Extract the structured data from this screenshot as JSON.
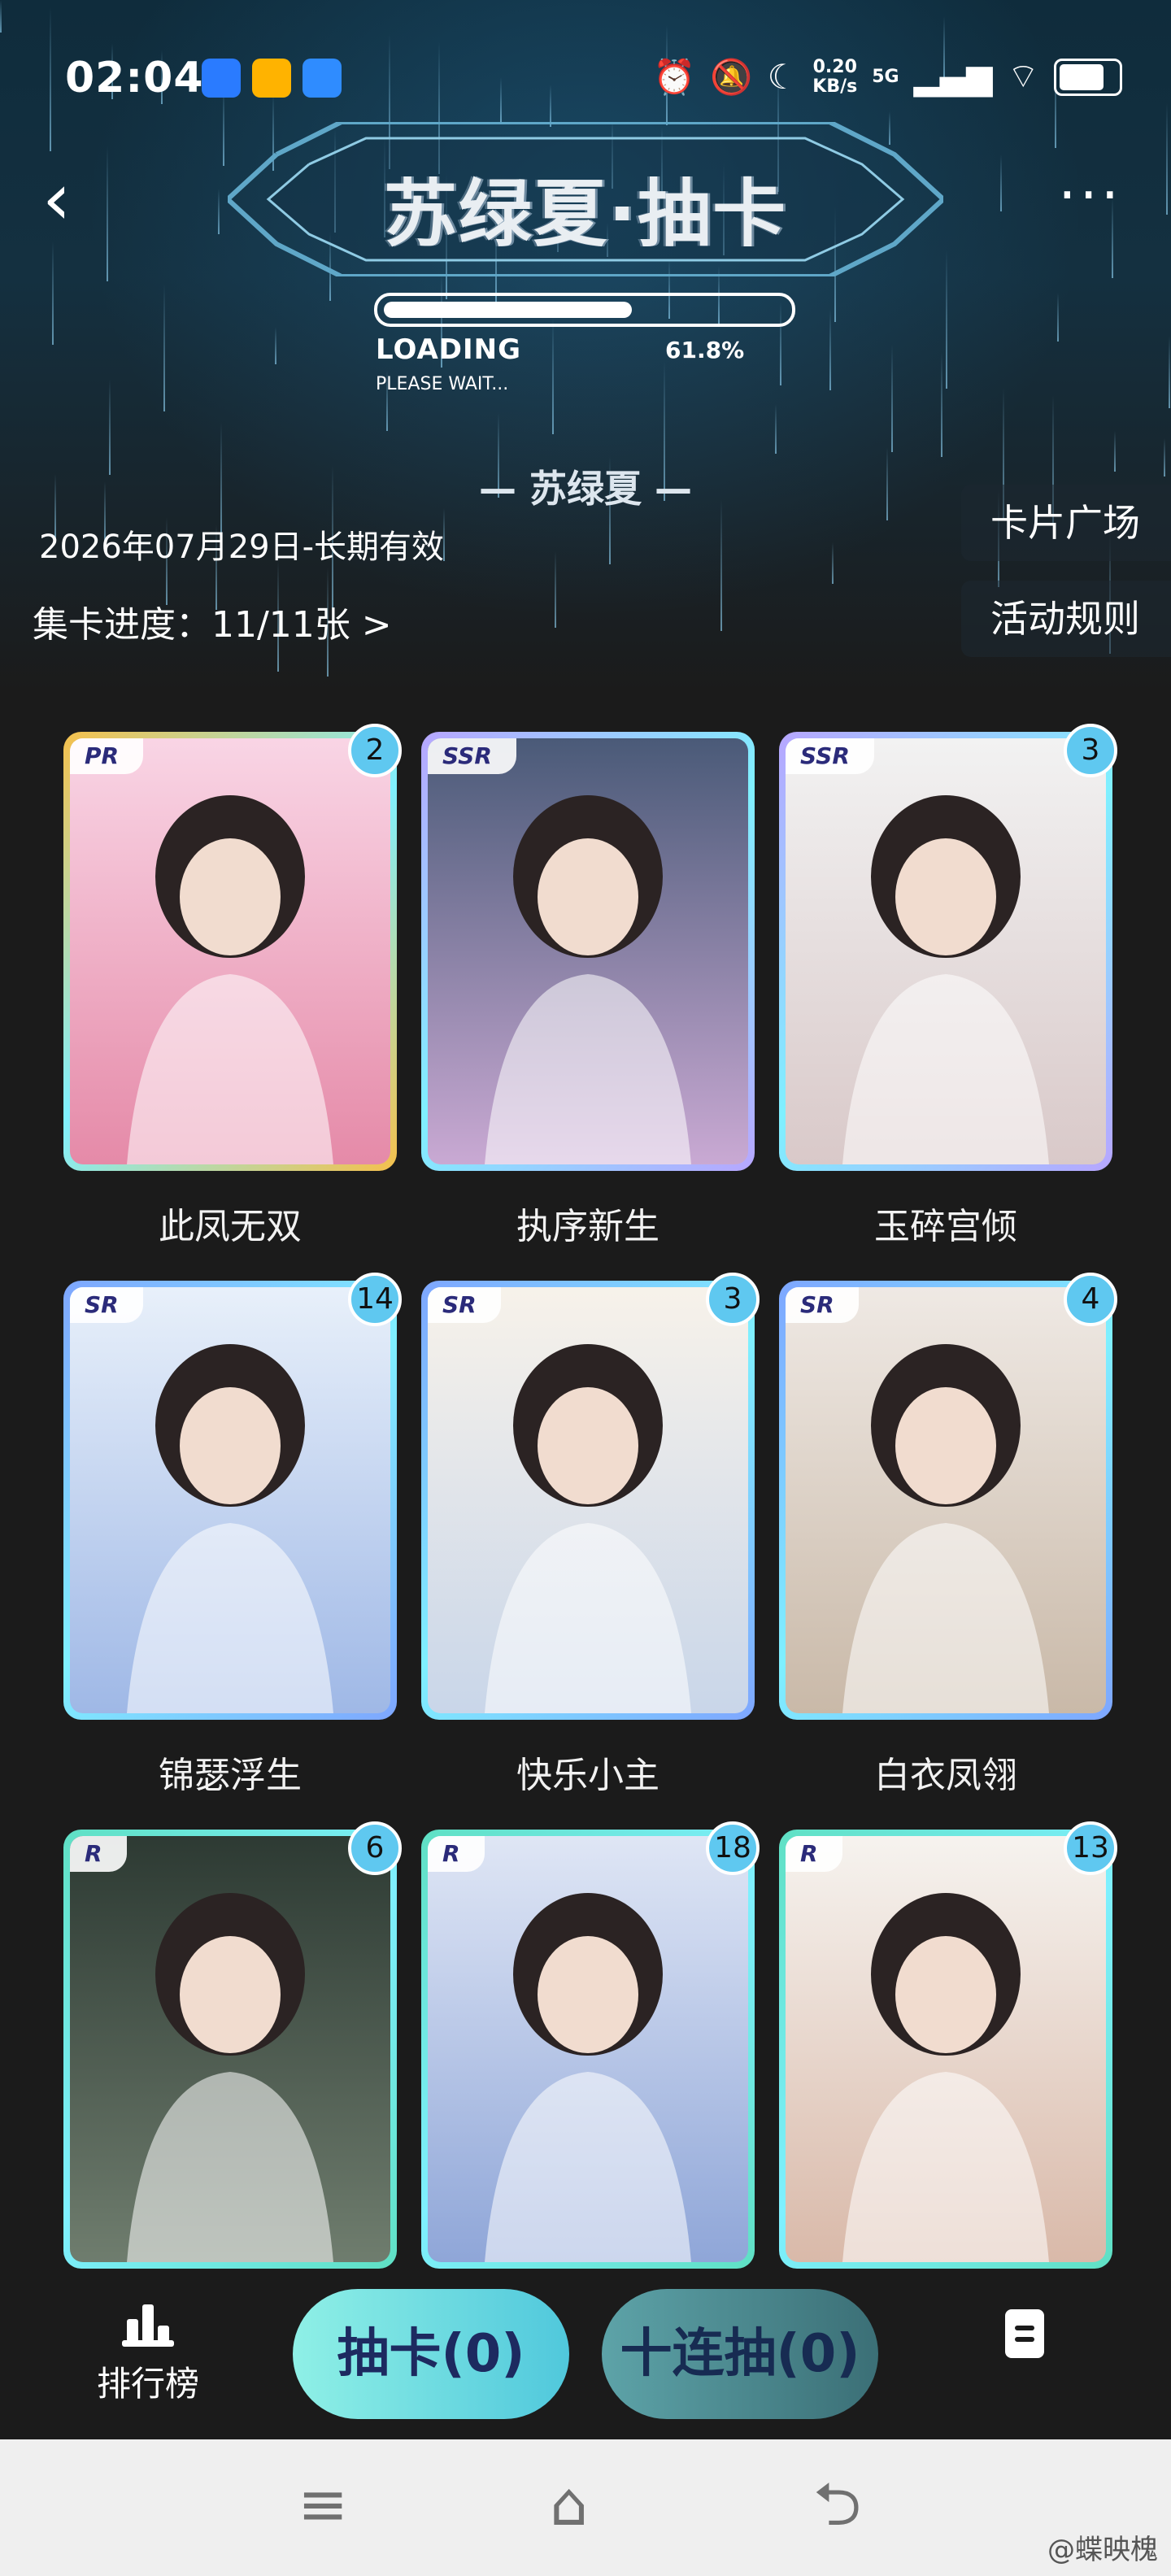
{
  "status_bar": {
    "time": "02:04",
    "speed_top": "0.20",
    "speed_bottom": "KB/s",
    "network": "5G",
    "battery_level": 0.85,
    "app_icon_colors": [
      "#2a7bff",
      "#ffb300",
      "#2f8cff"
    ]
  },
  "header": {
    "title": "苏绿夏·抽卡",
    "loading_label": "LOADING",
    "loading_percent": "61.8%",
    "loading_fraction": 0.618,
    "loading_sub": "PLEASE WAIT...",
    "celebrity_name": "— 苏绿夏 —",
    "validity": "2026年07月29日-长期有效",
    "progress_label": "集卡进度：11/11张 >",
    "side_buttons": [
      "卡片广场",
      "活动规则"
    ]
  },
  "cards": [
    {
      "rarity": "PR",
      "name": "此凤无双",
      "count": "2",
      "frame": "#f5c04c"
    },
    {
      "rarity": "SSR",
      "name": "执序新生",
      "count": "",
      "frame": "#b7a6ff"
    },
    {
      "rarity": "SSR",
      "name": "玉碎宫倾",
      "count": "3",
      "frame": "#b7a6ff"
    },
    {
      "rarity": "SR",
      "name": "锦瑟浮生",
      "count": "14",
      "frame": "#7ea6ff"
    },
    {
      "rarity": "SR",
      "name": "快乐小主",
      "count": "3",
      "frame": "#7ea6ff"
    },
    {
      "rarity": "SR",
      "name": "白衣凤翎",
      "count": "4",
      "frame": "#7ea6ff"
    },
    {
      "rarity": "R",
      "name": "",
      "count": "6",
      "frame": "#5fe0c4"
    },
    {
      "rarity": "R",
      "name": "",
      "count": "18",
      "frame": "#5fe0c4"
    },
    {
      "rarity": "R",
      "name": "",
      "count": "13",
      "frame": "#5fe0c4"
    }
  ],
  "bottom": {
    "rank_label": "排行榜",
    "draw_one": "抽卡(0)",
    "draw_ten": "十连抽(0)"
  },
  "nav": {
    "menu_icon": "menu-icon",
    "home_icon": "home-icon",
    "back_icon": "back-nav-icon"
  },
  "watermark": "@蝶映槐"
}
